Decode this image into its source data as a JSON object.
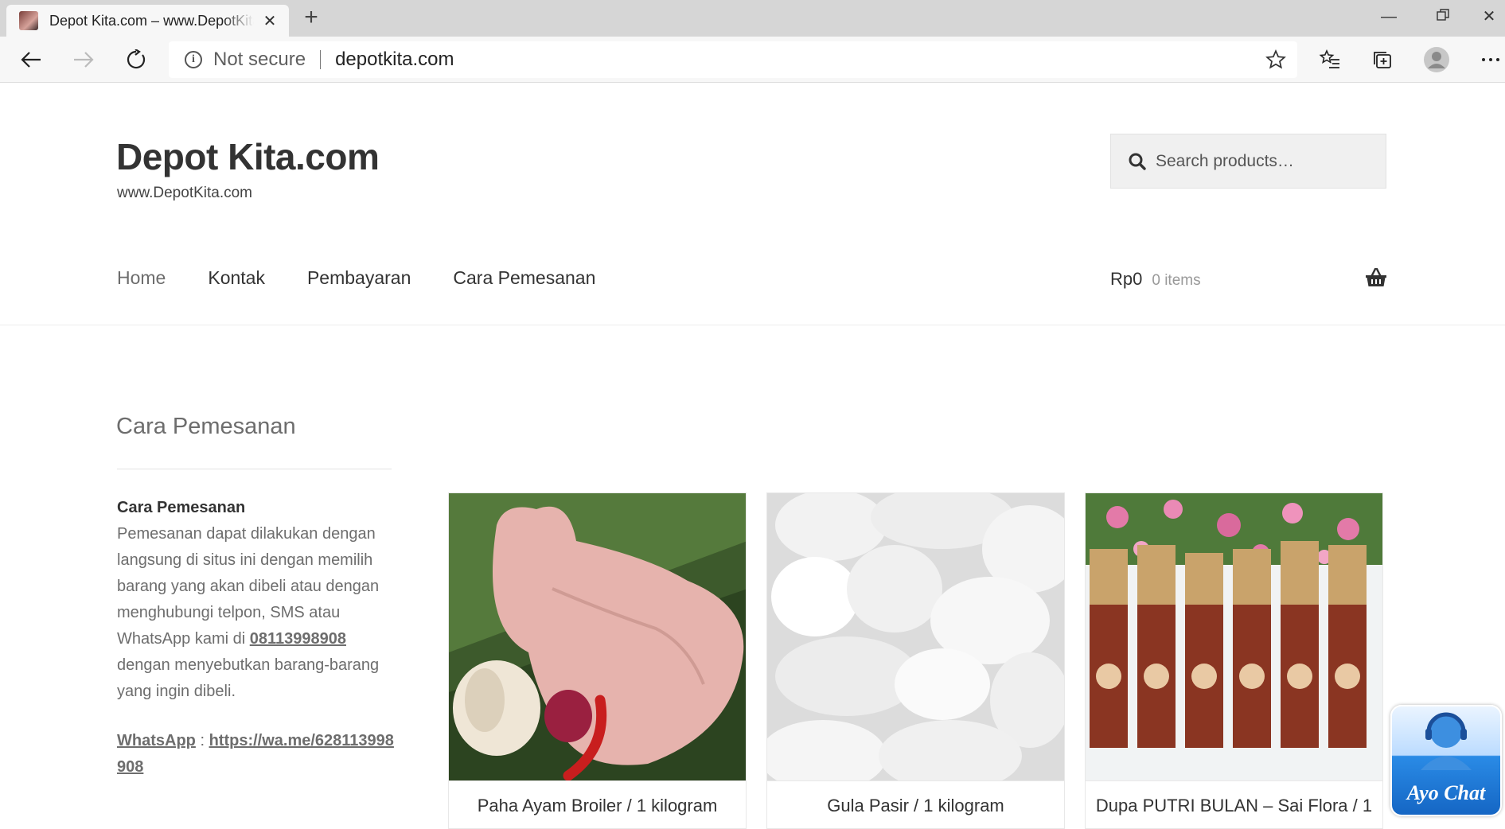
{
  "browser": {
    "tab_title": "Depot Kita.com – www.DepotKita.com",
    "security_label": "Not secure",
    "url": "depotkita.com",
    "icons": [
      "back-icon",
      "forward-icon",
      "refresh-icon",
      "info-icon",
      "star-icon",
      "favorites-icon",
      "collections-icon",
      "profile-icon",
      "more-icon"
    ]
  },
  "site": {
    "title": "Depot Kita.com",
    "description": "www.DepotKita.com",
    "search_placeholder": "Search products…"
  },
  "nav": {
    "items": [
      {
        "label": "Home"
      },
      {
        "label": "Kontak"
      },
      {
        "label": "Pembayaran"
      },
      {
        "label": "Cara Pemesanan"
      }
    ]
  },
  "cart": {
    "amount": "Rp0",
    "count": "0 items"
  },
  "sidebar": {
    "widget_title": "Cara Pemesanan",
    "heading": "Cara Pemesanan",
    "text_before_phone": "Pemesanan dapat dilakukan dengan langsung di situs ini dengan memilih barang yang akan dibeli atau dengan menghubungi telpon, SMS atau WhatsApp kami di ",
    "phone": "08113998908",
    "text_after_phone": " dengan menyebutkan barang-barang yang ingin dibeli.",
    "whatsapp_label": "WhatsApp",
    "whatsapp_sep": " : ",
    "whatsapp_link": "https://wa.me/628113998908"
  },
  "products": [
    {
      "name": "Paha Ayam Broiler / 1 kilogram"
    },
    {
      "name": "Gula Pasir / 1 kilogram"
    },
    {
      "name": "Dupa PUTRI BULAN – Sai Flora / 1"
    }
  ],
  "chat_widget": {
    "label": "Ayo Chat"
  },
  "colors": {
    "accent": "#333333",
    "muted": "#6d6d6d",
    "chat_blue": "#1f7ad8"
  }
}
